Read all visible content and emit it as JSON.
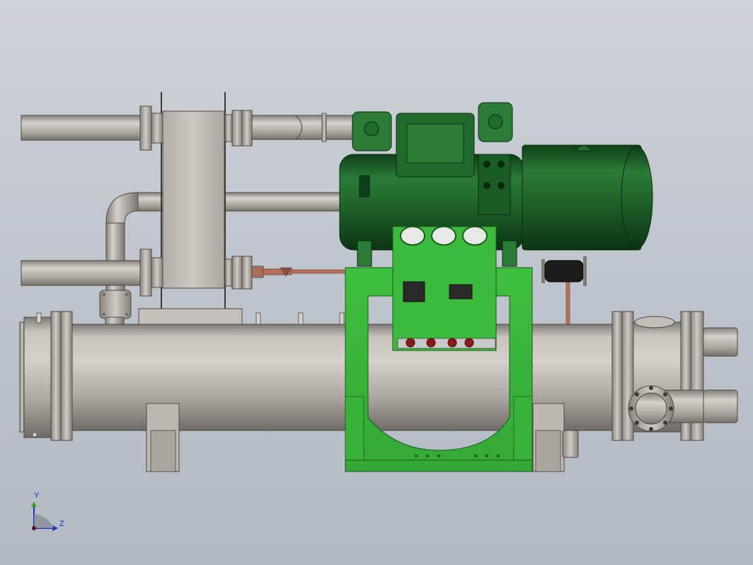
{
  "viewport": {
    "background": "#c5cad1"
  },
  "model": {
    "vessel_color": "#b9b4ad",
    "frame_color": "#3fbf3f",
    "compressor_color": "#1f6a2c",
    "copper_color": "#b87058"
  },
  "triad": {
    "y_label": "Y",
    "z_label": "Z",
    "axis_color": "#1c2fb8"
  }
}
